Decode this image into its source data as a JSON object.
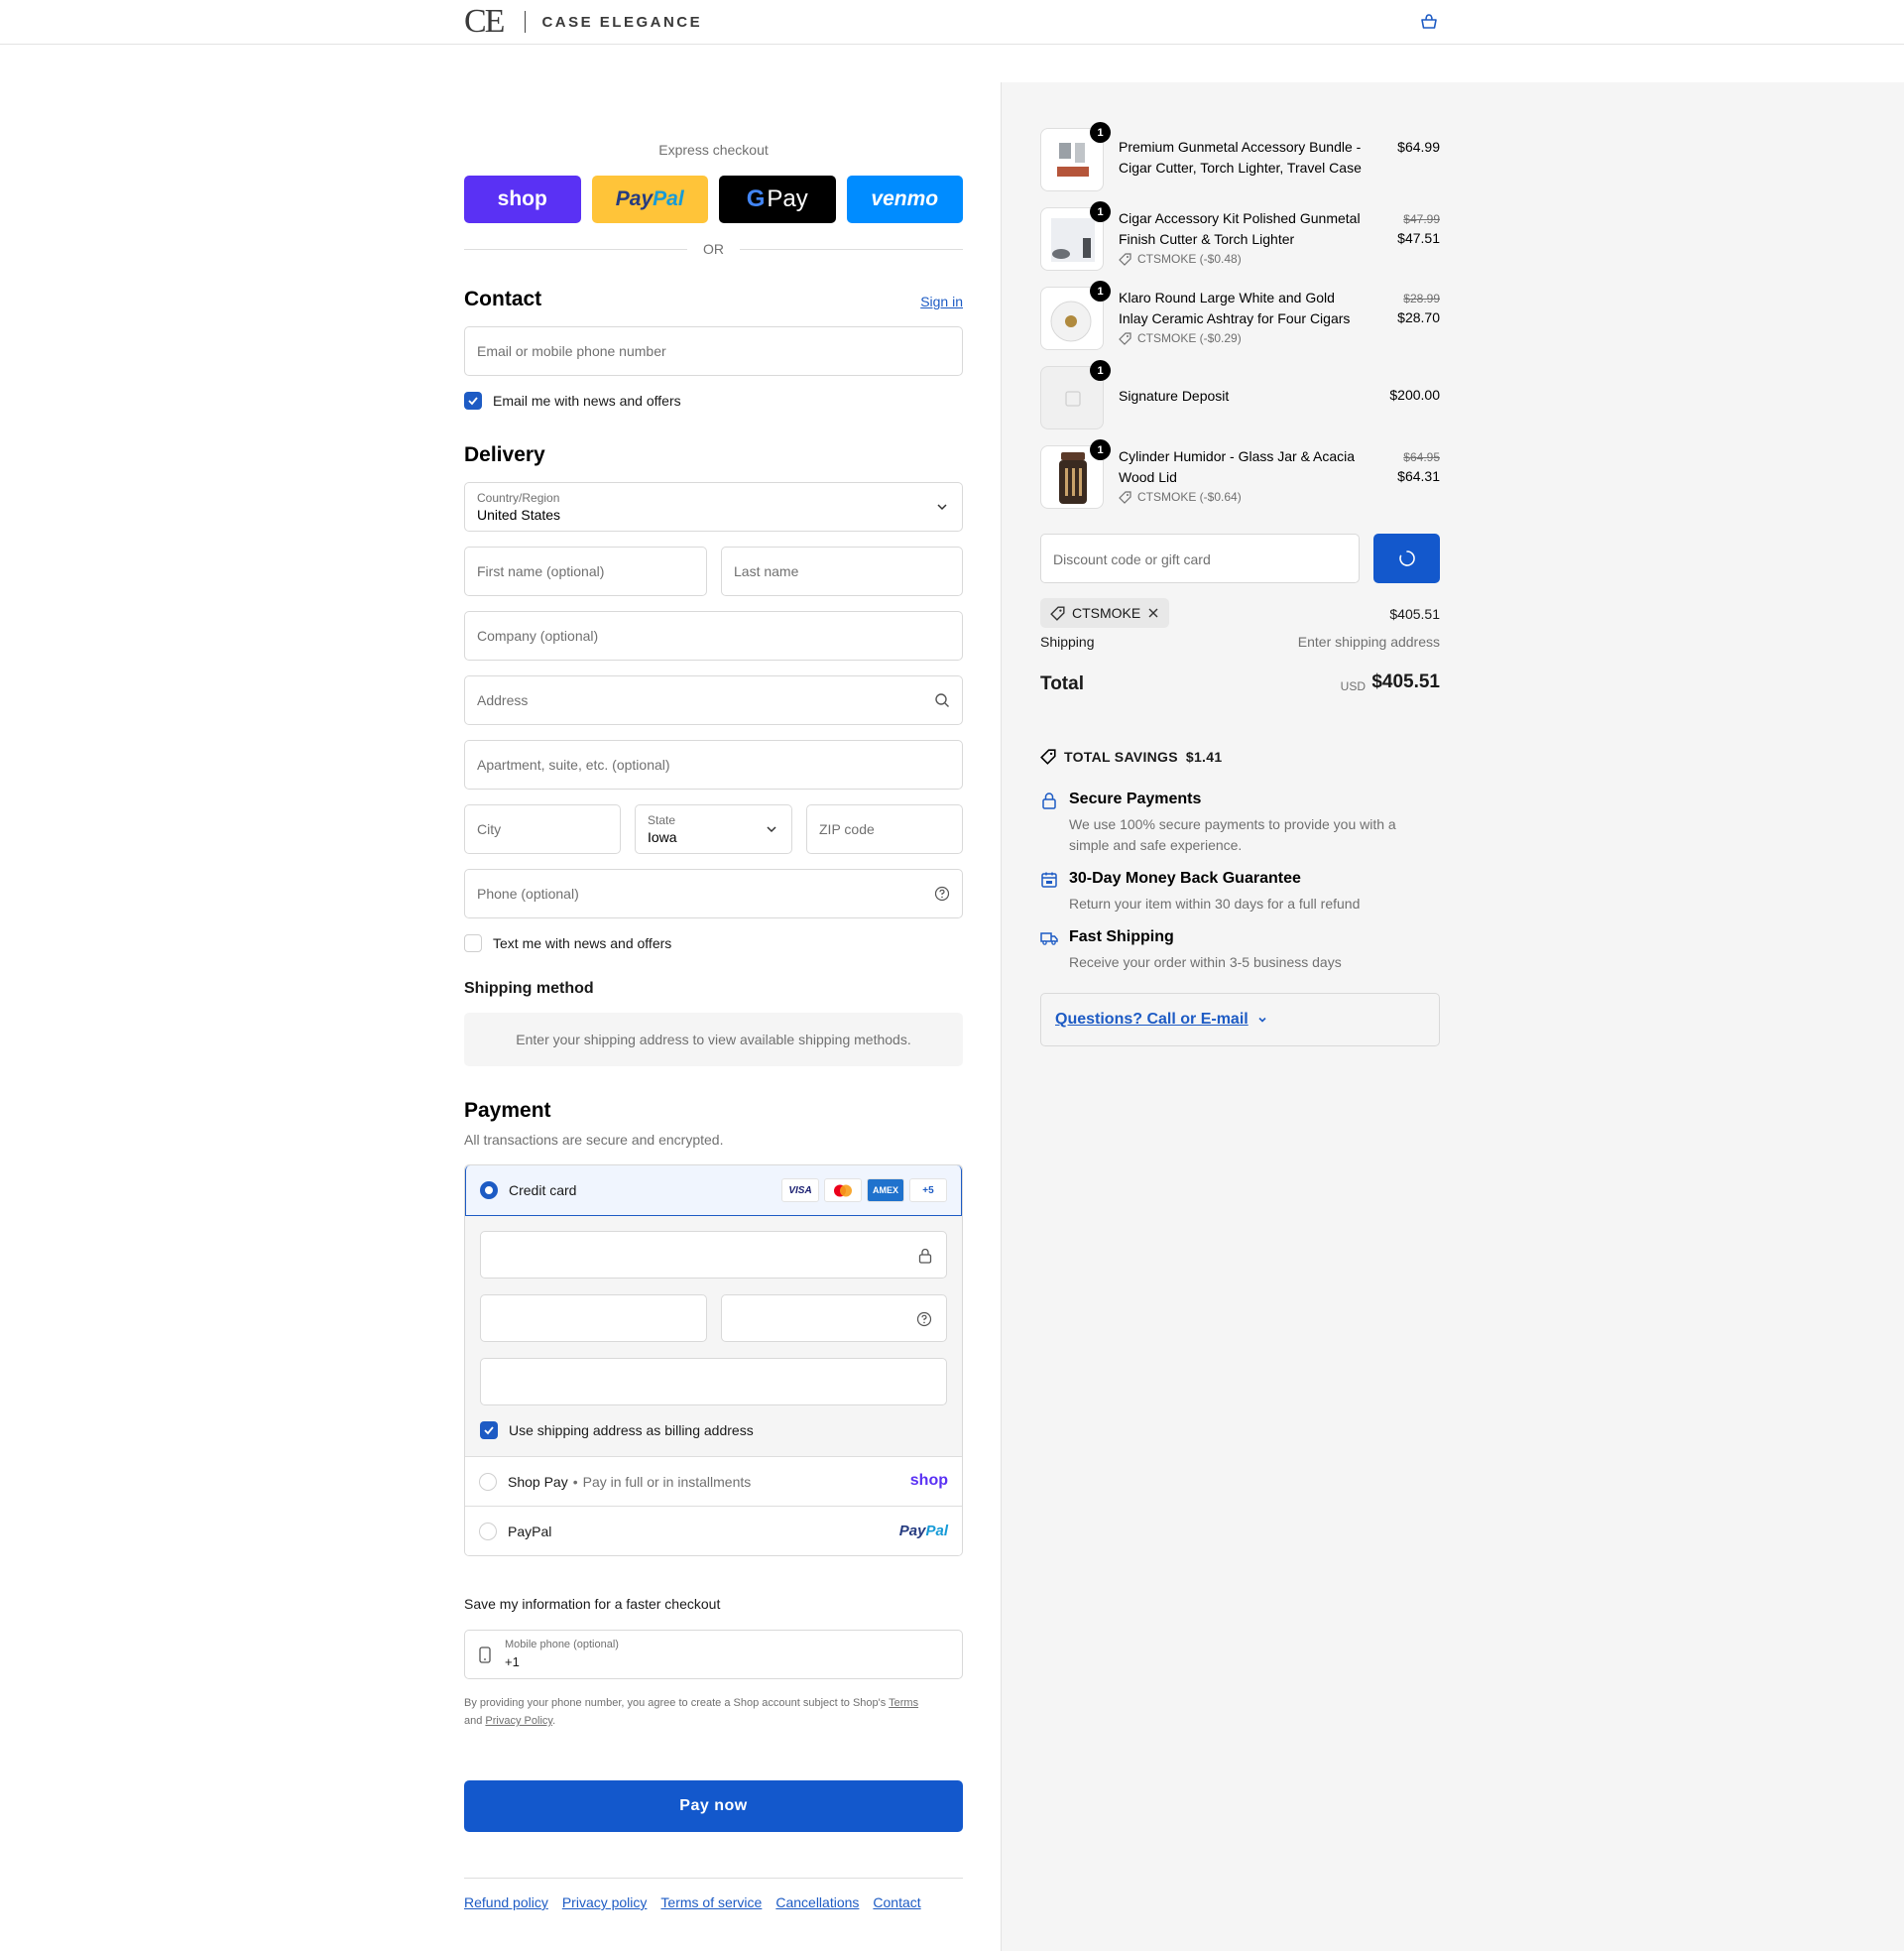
{
  "header": {
    "logo_mark": "CE",
    "logo_text": "CASE ELEGANCE"
  },
  "express": {
    "title": "Express checkout",
    "shop_label": "shop",
    "paypal_label_1": "Pay",
    "paypal_label_2": "Pal",
    "gpay_g": "G",
    "gpay_label": "Pay",
    "venmo_label": "venmo",
    "or_label": "OR"
  },
  "contact": {
    "title": "Contact",
    "sign_in": "Sign in",
    "email_placeholder": "Email or mobile phone number",
    "news_label": "Email me with news and offers",
    "news_checked": true
  },
  "delivery": {
    "title": "Delivery",
    "country_label": "Country/Region",
    "country_value": "United States",
    "first_name_placeholder": "First name (optional)",
    "last_name_placeholder": "Last name",
    "company_placeholder": "Company (optional)",
    "address_placeholder": "Address",
    "apartment_placeholder": "Apartment, suite, etc. (optional)",
    "city_placeholder": "City",
    "state_label": "State",
    "state_value": "Iowa",
    "zip_placeholder": "ZIP code",
    "phone_placeholder": "Phone (optional)",
    "text_label": "Text me with news and offers",
    "text_checked": false
  },
  "shipping_method": {
    "title": "Shipping method",
    "note": "Enter your shipping address to view available shipping methods."
  },
  "payment": {
    "title": "Payment",
    "subtitle": "All transactions are secure and encrypted.",
    "credit_card_label": "Credit card",
    "brands": [
      "VISA",
      "MC",
      "AMEX",
      "+5"
    ],
    "billing_label": "Use shipping address as billing address",
    "billing_checked": true,
    "shop_pay_label": "Shop Pay",
    "shop_pay_desc": "Pay in full or in installments",
    "shop_pay_logo": "shop",
    "paypal_label": "PayPal",
    "paypal_logo_1": "Pay",
    "paypal_logo_2": "Pal"
  },
  "save_info": {
    "title": "Save my information for a faster checkout",
    "mobile_label": "Mobile phone (optional)",
    "mobile_value": "+1",
    "legal_text": "By providing your phone number, you agree to create a Shop account subject to Shop's",
    "terms_link": "Terms",
    "and_text": "and",
    "privacy_link": "Privacy Policy",
    "period": "."
  },
  "pay_now": "Pay now",
  "footer": {
    "links": [
      "Refund policy",
      "Privacy policy",
      "Terms of service",
      "Cancellations",
      "Contact"
    ]
  },
  "order": {
    "items": [
      {
        "qty": "1",
        "name": "Premium Gunmetal Accessory Bundle - Cigar Cutter, Torch Lighter, Travel Case",
        "price": "$64.99"
      },
      {
        "qty": "1",
        "name": "Cigar Accessory Kit Polished Gunmetal Finish Cutter & Torch Lighter",
        "old_price": "$47.99",
        "price": "$47.51",
        "discount": "CTSMOKE (-$0.48)"
      },
      {
        "qty": "1",
        "name": "Klaro Round Large White and Gold Inlay Ceramic Ashtray for Four Cigars",
        "old_price": "$28.99",
        "price": "$28.70",
        "discount": "CTSMOKE (-$0.29)"
      },
      {
        "qty": "1",
        "name": "Signature Deposit",
        "price": "$200.00"
      },
      {
        "qty": "1",
        "name": "Cylinder Humidor - Glass Jar & Acacia Wood Lid",
        "old_price": "$64.95",
        "price": "$64.31",
        "discount": "CTSMOKE (-$0.64)"
      }
    ],
    "discount_placeholder": "Discount code or gift card",
    "applied_code": "CTSMOKE",
    "subtotal": "$405.51",
    "shipping_label": "Shipping",
    "shipping_value": "Enter shipping address",
    "total_label": "Total",
    "currency": "USD",
    "total": "$405.51"
  },
  "savings": {
    "label": "TOTAL SAVINGS",
    "amount": "$1.41"
  },
  "badges": [
    {
      "title": "Secure Payments",
      "desc": "We use 100% secure payments to provide you with a simple and safe experience."
    },
    {
      "title": "30-Day Money Back Guarantee",
      "desc": "Return your item within 30 days for a full refund"
    },
    {
      "title": "Fast Shipping",
      "desc": "Receive your order within 3-5 business days"
    }
  ],
  "questions": "Questions? Call or E-mail",
  "colors": {
    "accent": "#1358cc",
    "shop_purple": "#5a31f4",
    "paypal_yellow": "#ffc439",
    "venmo_blue": "#008cff"
  }
}
